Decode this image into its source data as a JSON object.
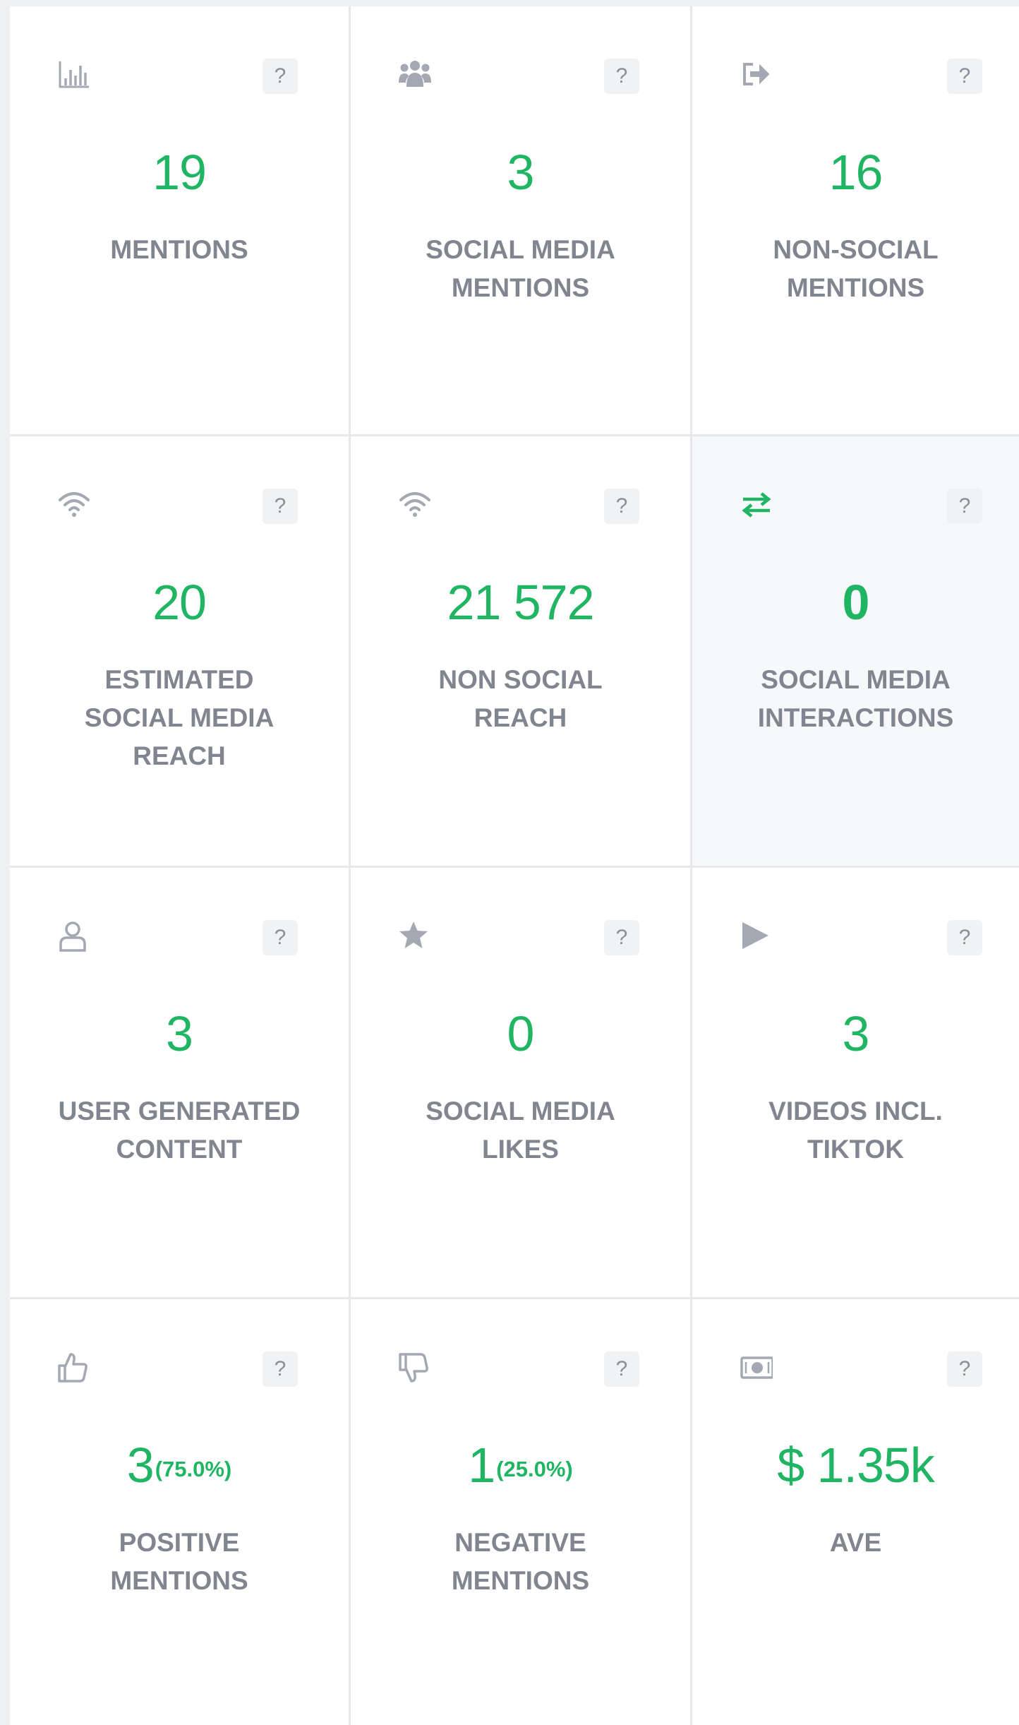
{
  "colors": {
    "accent": "#20b562",
    "label": "#80858f",
    "icon": "#a3a8b3",
    "help_bg": "#f1f2f4"
  },
  "help_label": "?",
  "cards": [
    {
      "icon": "bar-chart-icon",
      "value": "19",
      "label": "MENTIONS"
    },
    {
      "icon": "users-icon",
      "value": "3",
      "label": "SOCIAL MEDIA\nMENTIONS"
    },
    {
      "icon": "sign-out-icon",
      "value": "16",
      "label": "NON-SOCIAL\nMENTIONS"
    },
    {
      "icon": "wifi-icon",
      "value": "20",
      "label": "ESTIMATED\nSOCIAL MEDIA\nREACH"
    },
    {
      "icon": "wifi-icon",
      "value": "21 572",
      "label": "NON SOCIAL\nREACH"
    },
    {
      "icon": "exchange-icon",
      "value": "0",
      "label": "SOCIAL MEDIA\nINTERACTIONS"
    },
    {
      "icon": "user-icon",
      "value": "3",
      "label": "USER GENERATED\nCONTENT"
    },
    {
      "icon": "star-icon",
      "value": "0",
      "label": "SOCIAL MEDIA\nLIKES"
    },
    {
      "icon": "play-icon",
      "value": "3",
      "label": "VIDEOS INCL.\nTIKTOK"
    },
    {
      "icon": "thumbs-up-icon",
      "value": "3",
      "percent": "(75.0%)",
      "label": "POSITIVE\nMENTIONS"
    },
    {
      "icon": "thumbs-down-icon",
      "value": "1",
      "percent": "(25.0%)",
      "label": "NEGATIVE\nMENTIONS"
    },
    {
      "icon": "money-icon",
      "value": "$ 1.35k",
      "label": "AVE"
    }
  ]
}
